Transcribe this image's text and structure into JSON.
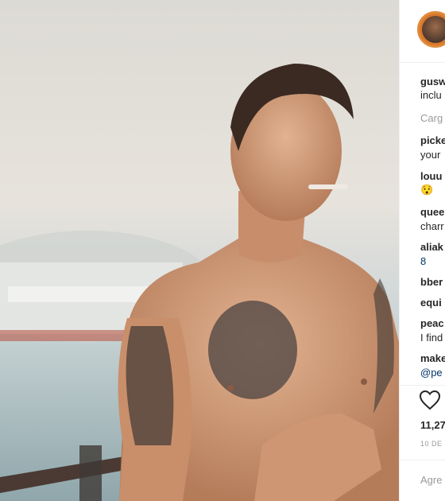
{
  "post": {
    "photo_label": "",
    "comments": [
      {
        "user": "gusw",
        "text": "inclu"
      },
      {
        "user": "",
        "text": "Carg"
      },
      {
        "user": "picke",
        "text": "your"
      },
      {
        "user": "louu",
        "text": "😯"
      },
      {
        "user": "quee",
        "text": "charr"
      },
      {
        "user": "aliak",
        "text": "8"
      },
      {
        "user": "bber",
        "text": ""
      },
      {
        "user": "equi",
        "text": ""
      },
      {
        "user": "peac",
        "text": "I find"
      },
      {
        "user": "make",
        "text": "@pe"
      }
    ],
    "likes": "11,27",
    "date": "10 DE",
    "add_comment_placeholder": "Agre"
  },
  "colors": {
    "accent_link": "#003569",
    "muted": "#999999",
    "text": "#262626",
    "avatar_ring": "#e08a3a"
  },
  "icons": {
    "like": "heart-icon"
  }
}
